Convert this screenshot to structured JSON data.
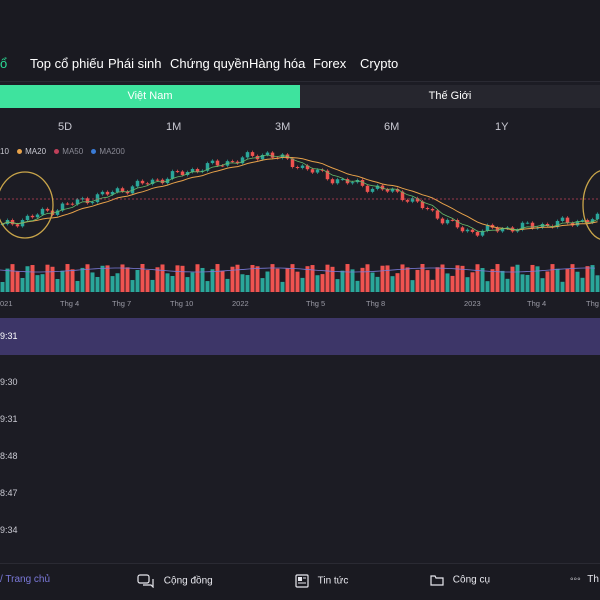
{
  "nav": {
    "items": [
      {
        "label": "ổ",
        "active": true
      },
      {
        "label": "Top cổ phiếu"
      },
      {
        "label": "Phái sinh"
      },
      {
        "label": "Chứng quyền"
      },
      {
        "label": "Hàng hóa"
      },
      {
        "label": "Forex"
      },
      {
        "label": "Crypto"
      }
    ]
  },
  "region": {
    "vietnam": "Việt Nam",
    "world": "Thế Giới"
  },
  "periods": [
    "5D",
    "1M",
    "3M",
    "6M",
    "1Y"
  ],
  "chart": {
    "legend": [
      {
        "label": "10",
        "color": "#e8e8ee"
      },
      {
        "label": "MA20",
        "color": "#e8a24a"
      },
      {
        "label": "MA50",
        "color": "#c0405a"
      },
      {
        "label": "MA200",
        "color": "#3a7bd5"
      }
    ],
    "x_labels": [
      "021",
      "Thg 4",
      "Thg 7",
      "Thg 10",
      "2022",
      "Thg 5",
      "Thg 8",
      "2023",
      "Thg 4",
      "Thg"
    ],
    "colors": {
      "up": "#2aa69a",
      "down": "#ef5350",
      "ma20": "#e8a24a",
      "ma10": "#66bb6a",
      "ref": "#c0405a"
    }
  },
  "chart_data": {
    "type": "candlestick",
    "x": [
      "2021-01",
      "2021-04",
      "2021-07",
      "2021-10",
      "2022-01",
      "2022-05",
      "2022-08",
      "2023-01",
      "2023-04",
      "2023-06"
    ],
    "close": [
      1080,
      1200,
      1300,
      1400,
      1480,
      1340,
      1260,
      1050,
      1080,
      1120
    ]
  },
  "list": {
    "times": [
      "9:31",
      "9:30",
      "9:31",
      "8:48",
      "8:47",
      "9:34"
    ]
  },
  "bottom_nav": [
    {
      "label": "Trang chủ",
      "icon": "home-icon",
      "active": true
    },
    {
      "label": "Cộng đồng",
      "icon": "chat-icon"
    },
    {
      "label": "Tin tức",
      "icon": "news-icon"
    },
    {
      "label": "Công cụ",
      "icon": "folder-icon"
    },
    {
      "label": "Th",
      "icon": "more-icon"
    }
  ]
}
